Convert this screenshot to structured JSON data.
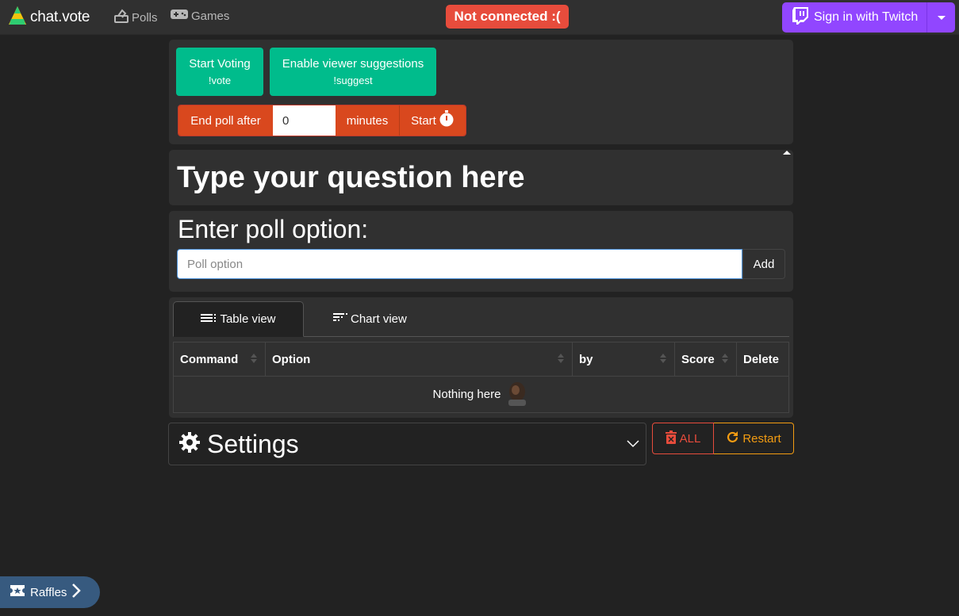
{
  "navbar": {
    "brand": "chat.vote",
    "polls_label": "Polls",
    "games_label": "Games",
    "status": "Not connected :(",
    "twitch_label": "Sign in with Twitch",
    "colors": {
      "status": "#e74c3c",
      "twitch": "#9146ff"
    }
  },
  "controls": {
    "start_voting": "Start Voting",
    "start_voting_cmd": "!vote",
    "suggestions": "Enable viewer suggestions",
    "suggestions_cmd": "!suggest",
    "end_poll_label": "End poll after",
    "minutes_value": "0",
    "minutes_label": "minutes",
    "start_label": "Start",
    "colors": {
      "accent": "#00bc8c",
      "timer": "#d9481e"
    }
  },
  "question": {
    "text": "Type your question here"
  },
  "option": {
    "label": "Enter poll option:",
    "placeholder": "Poll option",
    "add_label": "Add"
  },
  "tabs": [
    {
      "label": "Table view",
      "icon": "list-icon",
      "active": true
    },
    {
      "label": "Chart view",
      "icon": "bar-chart-icon",
      "active": false
    }
  ],
  "table": {
    "columns": [
      "Command",
      "Option",
      "by",
      "Score",
      "Delete"
    ],
    "empty_text": "Nothing here"
  },
  "settings": {
    "label": "Settings"
  },
  "actions": {
    "all_label": "ALL",
    "restart_label": "Restart"
  },
  "raffles": {
    "label": "Raffles"
  }
}
